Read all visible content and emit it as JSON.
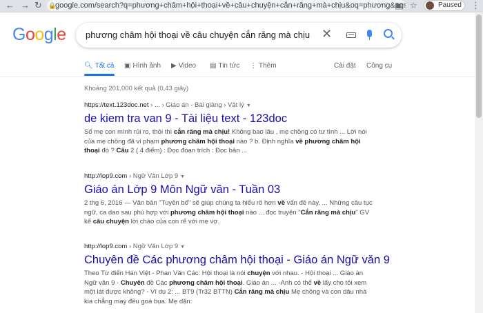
{
  "browser": {
    "url": "google.com/search?q=phương+châm+hội+thoại+về+câu+chuyện+cắn+răng+mà+chịu&oq=phương&aqs...",
    "profile_status": "Paused"
  },
  "logo": [
    "G",
    "o",
    "o",
    "g",
    "l",
    "e"
  ],
  "search": {
    "query": "phương châm hội thoại về câu chuyện cắn răng mà chịu"
  },
  "tabs": {
    "all": "Tất cả",
    "images": "Hình ảnh",
    "video": "Video",
    "news": "Tin tức",
    "more": "Thêm",
    "settings": "Cài đặt",
    "tools": "Công cụ"
  },
  "stats": "Khoảng 201.000 kết quả (0,43 giây)",
  "results": [
    {
      "url": "https://text.123doc.net",
      "crumbs": " › ... › Giáo án - Bài giảng › Vật lý",
      "title": "de kiem tra van 9 - Tài liệu text - 123doc",
      "snippet": [
        {
          "t": "Số mẹ con mình rủi ro, thôi thì ",
          "b": false
        },
        {
          "t": "cắn răng mà chịu!",
          "b": true
        },
        {
          "t": " Không bao lâu , mẹ chồng có tư tình ... Lời nói của mẹ chồng đã vi phạm ",
          "b": false
        },
        {
          "t": "phương châm hội thoại",
          "b": true
        },
        {
          "t": " nào ? b. Định nghĩa ",
          "b": false
        },
        {
          "t": "về phương châm hội thoại",
          "b": true
        },
        {
          "t": " đó ? ",
          "b": false
        },
        {
          "t": "Câu",
          "b": true
        },
        {
          "t": " 2 ( 4 điểm) : Đọc đoạn trích : Đọc bản ...",
          "b": false
        }
      ]
    },
    {
      "url": "http://lop9.com",
      "crumbs": " › Ngữ Văn Lớp 9",
      "title": "Giáo án Lớp 9 Môn Ngữ văn - Tuần 03",
      "snippet": [
        {
          "t": "2 thg 6, 2016 — Văn bản \"Tuyên bố\" sẽ giúp chúng ta hiểu rõ hơn ",
          "b": false
        },
        {
          "t": "về",
          "b": true
        },
        {
          "t": " vấn đề này. ... Những câu tục ngữ, ca dao sau phù hợp với ",
          "b": false
        },
        {
          "t": "phương châm hội thoại",
          "b": true
        },
        {
          "t": " nào ... đọc truyện \"",
          "b": false
        },
        {
          "t": "Cắn răng mà chịu",
          "b": true
        },
        {
          "t": "\" GV kể ",
          "b": false
        },
        {
          "t": "câu chuyện",
          "b": true
        },
        {
          "t": " lời chào của con rể với mẹ vợ.",
          "b": false
        }
      ]
    },
    {
      "url": "http://lop9.com",
      "crumbs": " › Ngữ Văn Lớp 9",
      "title": "Chuyên đề Các phương châm hội thoại - Giáo án Ngữ văn 9",
      "snippet": [
        {
          "t": "Theo Từ điển Hán Việt - Phan Văn Các: Hội thoại là nói ",
          "b": false
        },
        {
          "t": "chuyện",
          "b": true
        },
        {
          "t": " với nhau. - Hội thoại ... Giáo án Ngữ văn 9 - ",
          "b": false
        },
        {
          "t": "Chuyên",
          "b": true
        },
        {
          "t": " đề Các ",
          "b": false
        },
        {
          "t": "phương châm hội thoại",
          "b": true
        },
        {
          "t": ". Giáo án ... -Anh có thể ",
          "b": false
        },
        {
          "t": "về",
          "b": true
        },
        {
          "t": " lấy cho tôi xem một lát được không? - Ví dụ 2: ... BT9 (Tr32 BTTN) ",
          "b": false
        },
        {
          "t": "Cắn răng mà chịu",
          "b": true
        },
        {
          "t": " Mẹ chồng và con dâu nhà kia chẳng may đều goá bụa. Mẹ dặn:",
          "b": false
        }
      ]
    }
  ],
  "colors": {
    "link": "#1a0dab",
    "accent": "#1a73e8",
    "snippet": "#4d5156"
  }
}
